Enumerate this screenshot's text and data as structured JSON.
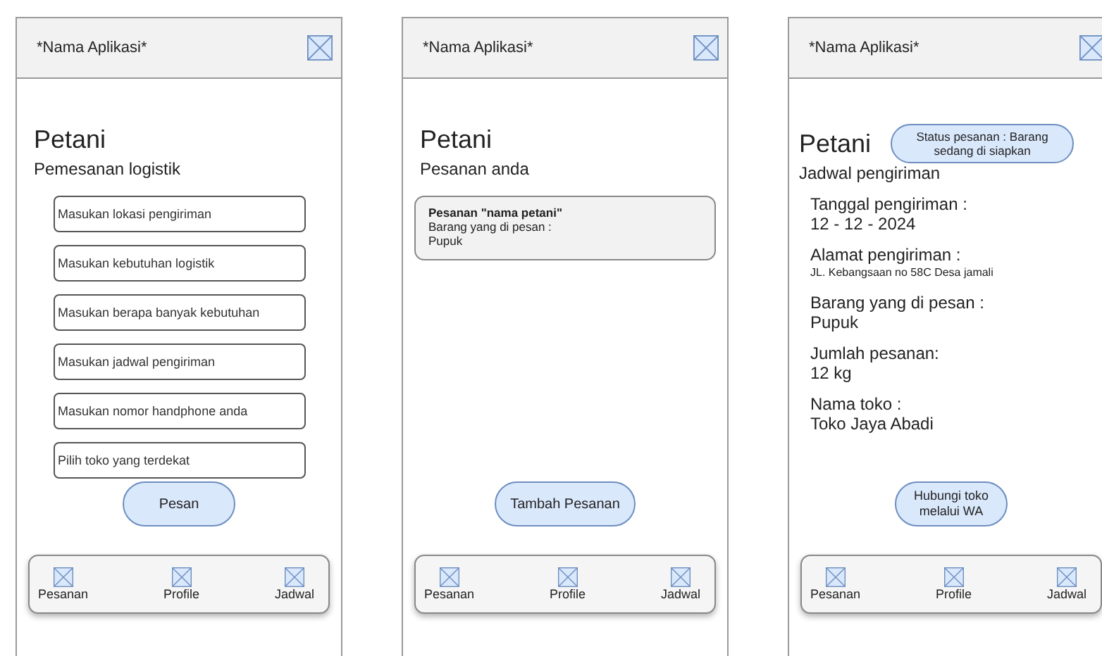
{
  "screens": [
    {
      "kind": "form",
      "app_title": "*Nama Aplikasi*",
      "title": "Petani",
      "subtitle": "Pemesanan logistik",
      "fields": [
        {
          "placeholder": "Masukan lokasi pengiriman"
        },
        {
          "placeholder": "Masukan kebutuhan logistik"
        },
        {
          "placeholder": "Masukan berapa banyak kebutuhan"
        },
        {
          "placeholder": "Masukan jadwal pengiriman"
        },
        {
          "placeholder": "Masukan nomor handphone anda"
        },
        {
          "placeholder": "Pilih toko yang terdekat"
        }
      ],
      "button": "Pesan",
      "nav": [
        "Pesanan",
        "Profile",
        "Jadwal"
      ]
    },
    {
      "kind": "orders",
      "app_title": "*Nama Aplikasi*",
      "title": "Petani",
      "subtitle": "Pesanan anda",
      "orders": [
        {
          "title": "Pesanan \"nama petani\"",
          "lines": [
            "Barang yang di pesan :",
            "Pupuk"
          ]
        }
      ],
      "button": "Tambah Pesanan",
      "nav": [
        "Pesanan",
        "Profile",
        "Jadwal"
      ]
    },
    {
      "kind": "schedule",
      "app_title": "*Nama Aplikasi*",
      "title": "Petani",
      "status": "Status pesanan : Barang sedang di siapkan",
      "subtitle": "Jadwal pengiriman",
      "details": [
        {
          "label": "Tanggal pengiriman :",
          "value": "12 - 12 - 2024",
          "compact": false
        },
        {
          "label": "Alamat pengiriman :",
          "value": "JL. Kebangsaan no 58C Desa jamali",
          "compact": true
        },
        {
          "label": "Barang yang di pesan :",
          "value": "Pupuk",
          "compact": false
        },
        {
          "label": "Jumlah pesanan:",
          "value": "12 kg",
          "compact": false
        },
        {
          "label": "Nama toko :",
          "value": "Toko Jaya Abadi",
          "compact": false
        }
      ],
      "button": "Hubungi toko melalui WA",
      "nav": [
        "Pesanan",
        "Profile",
        "Jadwal"
      ]
    }
  ]
}
